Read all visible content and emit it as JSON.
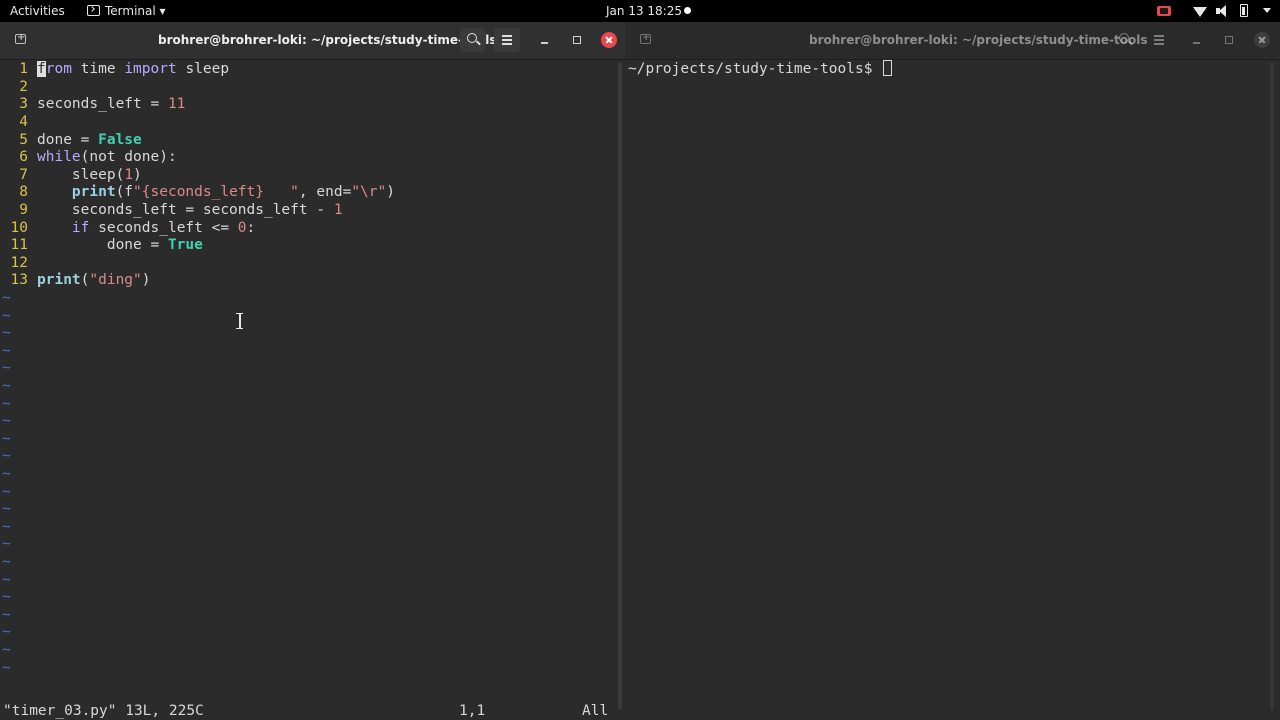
{
  "topbar": {
    "activities": "Activities",
    "app_menu": "Terminal",
    "clock": "Jan 13  18:25"
  },
  "left_window": {
    "title": "brohrer@brohrer-loki: ~/projects/study-time-tools",
    "editor": {
      "lines": [
        {
          "n": "1"
        },
        {
          "n": "2"
        },
        {
          "n": "3"
        },
        {
          "n": "4"
        },
        {
          "n": "5"
        },
        {
          "n": "6"
        },
        {
          "n": "7"
        },
        {
          "n": "8"
        },
        {
          "n": "9"
        },
        {
          "n": "10"
        },
        {
          "n": "11"
        },
        {
          "n": "12"
        },
        {
          "n": "13"
        }
      ],
      "code": {
        "l1_cursor": "f",
        "l1_rest": "rom",
        "l1_tail": " time ",
        "l1_import": "import",
        "l1_sleep": " sleep",
        "l3_var": "seconds_left = ",
        "l3_val": "11",
        "l5_var": "done = ",
        "l5_val": "False",
        "l6_while": "while",
        "l6_rest": "(not done):",
        "l7": "    sleep(",
        "l7_num": "1",
        "l7_end": ")",
        "l8_indent": "    ",
        "l8_print": "print",
        "l8_f": "(f",
        "l8_str": "\"{seconds_left}   \"",
        "l8_end_a": ", end=",
        "l8_end_str": "\"\\r\"",
        "l8_close": ")",
        "l9": "    seconds_left = seconds_left - ",
        "l9_num": "1",
        "l10_if": "    if",
        "l10_rest": " seconds_left <= ",
        "l10_num": "0",
        "l10_colon": ":",
        "l11_a": "        done = ",
        "l11_true": "True",
        "l13_print": "print",
        "l13_open": "(",
        "l13_str": "\"ding\"",
        "l13_close": ")"
      },
      "tilde": "~",
      "status_file": "\"timer_03.py\" 13L, 225C",
      "status_pos": "1,1",
      "status_all": "All"
    }
  },
  "right_window": {
    "title": "brohrer@brohrer-loki: ~/projects/study-time-tools",
    "prompt": "~/projects/study-time-tools$ "
  }
}
